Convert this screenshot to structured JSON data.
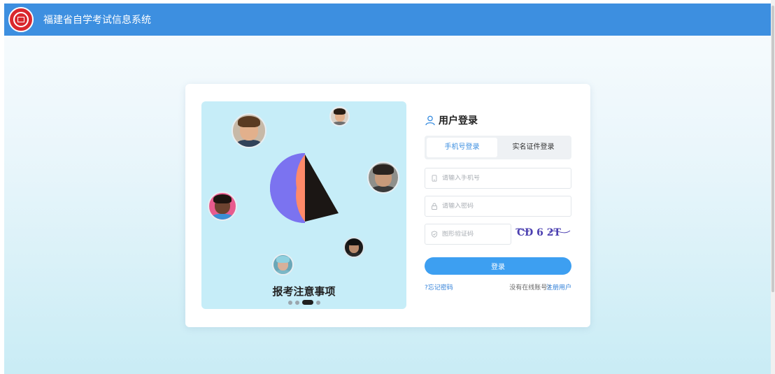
{
  "header": {
    "title": "福建省自学考试信息系统",
    "logo_icon": "seal-logo-icon"
  },
  "banner": {
    "caption": "报考注意事项",
    "carousel": {
      "total": 4,
      "active_index": 2
    }
  },
  "login": {
    "title": "用户登录",
    "tabs": [
      {
        "label": "手机号登录",
        "active": true
      },
      {
        "label": "实名证件登录",
        "active": false
      }
    ],
    "phone_placeholder": "请输入手机号",
    "password_placeholder": "请输入密码",
    "captcha_placeholder": "图形验证码",
    "captcha_text": "CD 6 2T",
    "submit_label": "登录",
    "forgot_link": "?忘记密码",
    "no_account_text": "没有在线账号?",
    "register_link": "注册用户"
  },
  "colors": {
    "topbar": "#3d8fe0",
    "accent": "#3d9ff1",
    "banner_bg": "#c6edf8"
  }
}
